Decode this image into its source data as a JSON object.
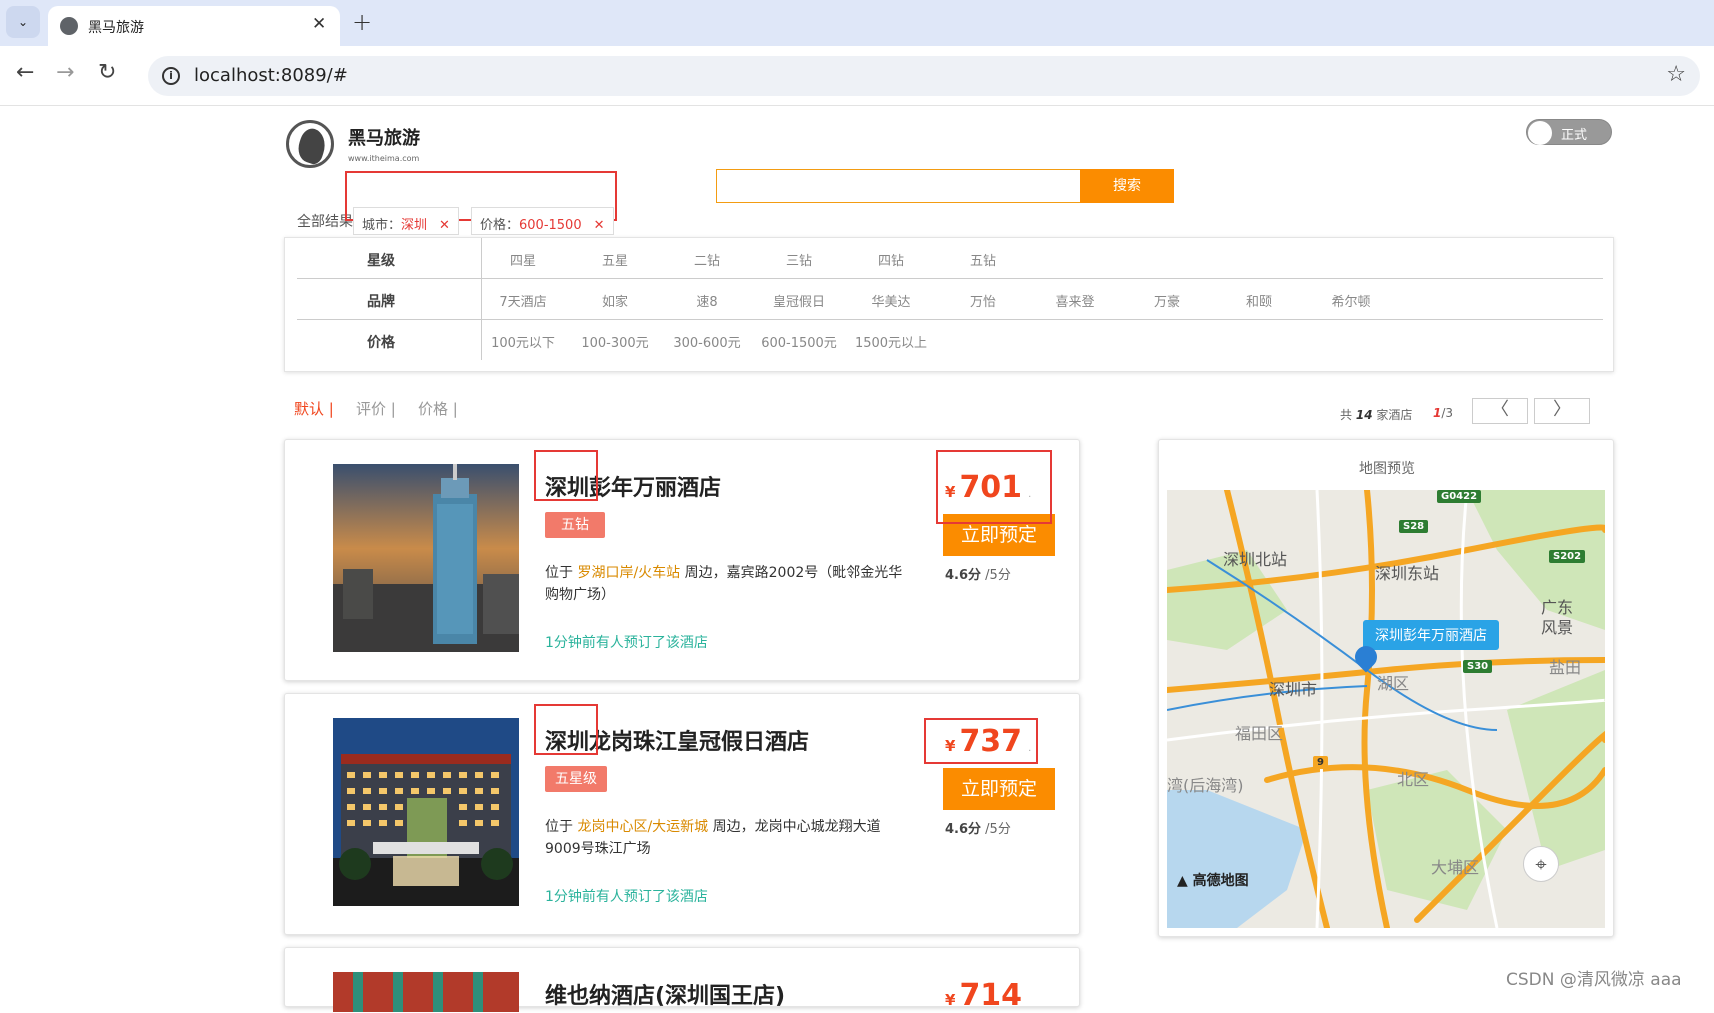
{
  "browser": {
    "tab_title": "黑马旅游",
    "tab_close": "✕",
    "new_tab": "+",
    "url": "localhost:8089/#"
  },
  "header": {
    "logo_name": "黑马旅游",
    "logo_url": "www.itheima.com",
    "toggle_label": "正式",
    "search_placeholder": "",
    "search_button": "搜索"
  },
  "active_filters": {
    "label": "全部结果：",
    "tags": [
      {
        "key": "城市：",
        "value": "深圳",
        "remove": "✕"
      },
      {
        "key": "价格：",
        "value": "600-1500",
        "remove": "✕"
      }
    ]
  },
  "filter_panel": {
    "rows": [
      {
        "label": "星级",
        "options": [
          "四星",
          "五星",
          "二钻",
          "三钻",
          "四钻",
          "五钻"
        ]
      },
      {
        "label": "品牌",
        "options": [
          "7天酒店",
          "如家",
          "速8",
          "皇冠假日",
          "华美达",
          "万怡",
          "喜来登",
          "万豪",
          "和颐",
          "希尔顿"
        ]
      },
      {
        "label": "价格",
        "options": [
          "100元以下",
          "100-300元",
          "300-600元",
          "600-1500元",
          "1500元以上"
        ]
      }
    ]
  },
  "sort": {
    "options": [
      "默认 |",
      "评价 |",
      "价格 |"
    ],
    "active_index": 0
  },
  "pagination": {
    "total_prefix": "共",
    "total": "14",
    "total_suffix": "家酒店",
    "current": "1",
    "pages": "/3",
    "prev": "〈",
    "next": "〉"
  },
  "hotels": [
    {
      "name": "深圳彭年万丽酒店",
      "star": "五钻",
      "addr_prefix": "位于",
      "area": "罗湖口岸/火车站",
      "address": "周边，嘉宾路2002号（毗邻金光华购物广场）",
      "recent": "1分钟前有人预订了该酒店",
      "currency": "¥",
      "price": "701",
      "price_suffix": ".",
      "book": "立即预定",
      "score": "4.6分",
      "score_max": "/5分"
    },
    {
      "name": "深圳龙岗珠江皇冠假日酒店",
      "star": "五星级",
      "addr_prefix": "位于",
      "area": "龙岗中心区/大运新城",
      "address": "周边，龙岗中心城龙翔大道9009号珠江广场",
      "recent": "1分钟前有人预订了该酒店",
      "currency": "¥",
      "price": "737",
      "price_suffix": ".",
      "book": "立即预定",
      "score": "4.6分",
      "score_max": "/5分"
    },
    {
      "name": "维也纳酒店(深圳国王店)",
      "currency": "¥",
      "price": "714"
    }
  ],
  "map_preview": {
    "title": "地图预览",
    "marker_label": "深圳彭年万丽酒店",
    "labels": [
      "深圳北站",
      "深圳东站",
      "深圳市",
      "福田区",
      "湾(后海湾)",
      "湖区",
      "北区",
      "大埔区",
      "广东",
      "风景",
      "盐田"
    ],
    "road_badges": [
      "G0422",
      "S28",
      "S202",
      "S30",
      "9"
    ],
    "brand": "高德地图"
  },
  "watermark": "CSDN @清风微凉 aaa",
  "colors": {
    "accent_orange": "#fb8c00",
    "price_red": "#f0461e",
    "highlight_red": "#e53935",
    "recent_green": "#2bb39c",
    "badge_salmon": "#f27a6a"
  }
}
